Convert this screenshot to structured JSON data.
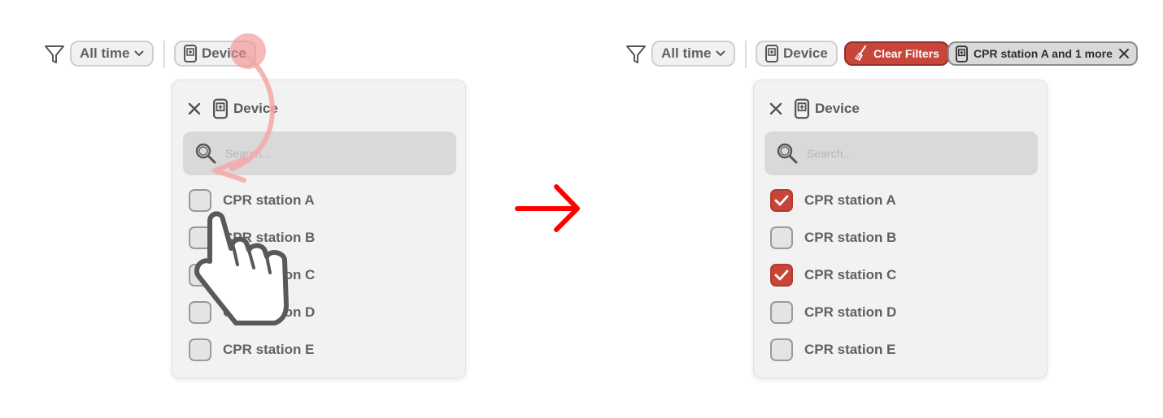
{
  "colors": {
    "accent": "#c8453a",
    "arrow": "#ff0000",
    "gesture_path": "#f4a7a7"
  },
  "before": {
    "toolbar": {
      "time_label": "All time",
      "device_label": "Device"
    },
    "popover": {
      "title": "Device",
      "search_placeholder": "Search...",
      "options": [
        {
          "label": "CPR station A",
          "checked": false
        },
        {
          "label": "CPR station B",
          "checked": false
        },
        {
          "label": "CPR station C",
          "checked": false
        },
        {
          "label": "CPR station D",
          "checked": false
        },
        {
          "label": "CPR station E",
          "checked": false
        }
      ]
    }
  },
  "after": {
    "toolbar": {
      "time_label": "All time",
      "device_label": "Device",
      "clear_label": "Clear Filters",
      "chip_label": "CPR station A and 1 more"
    },
    "popover": {
      "title": "Device",
      "search_placeholder": "Search...",
      "options": [
        {
          "label": "CPR station A",
          "checked": true
        },
        {
          "label": "CPR station B",
          "checked": false
        },
        {
          "label": "CPR station C",
          "checked": true
        },
        {
          "label": "CPR station D",
          "checked": false
        },
        {
          "label": "CPR station E",
          "checked": false
        }
      ]
    }
  }
}
